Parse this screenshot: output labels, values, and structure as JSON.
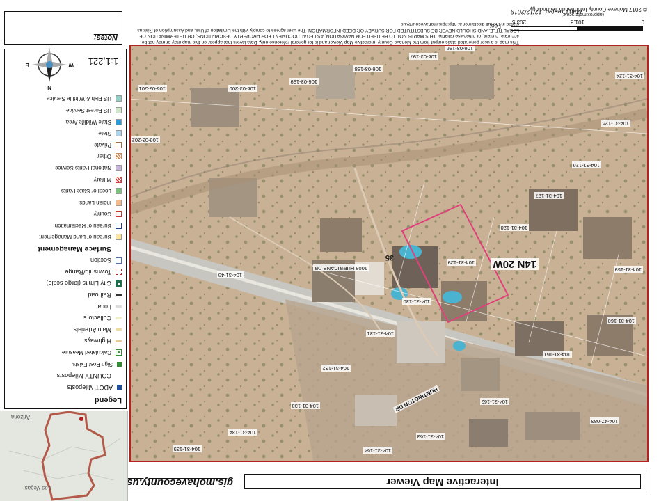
{
  "header": {
    "title": "Interactive Map Viewer",
    "url": "gis.mohavecounty.us"
  },
  "inset": {
    "labels": [
      "Las Vegas",
      "Arizona"
    ]
  },
  "map": {
    "parcels": [
      {
        "id": "p1",
        "text": "106-03-201"
      },
      {
        "id": "p2",
        "text": "106-03-200"
      },
      {
        "id": "p3",
        "text": "106-03-199"
      },
      {
        "id": "p4",
        "text": "106-03-198"
      },
      {
        "id": "p5",
        "text": "106-03-197"
      },
      {
        "id": "p6",
        "text": "106-03-196"
      },
      {
        "id": "p7",
        "text": "106-03-202"
      },
      {
        "id": "p8",
        "text": "104-31-124"
      },
      {
        "id": "p9",
        "text": "104-31-125"
      },
      {
        "id": "p10",
        "text": "104-31-126"
      },
      {
        "id": "p11",
        "text": "104-31-127"
      },
      {
        "id": "p12",
        "text": "104-31-128"
      },
      {
        "id": "p13",
        "text": "104-31-129"
      },
      {
        "id": "p14",
        "text": "104-31-130"
      },
      {
        "id": "p15",
        "text": "104-31-131"
      },
      {
        "id": "p16",
        "text": "104-31-132"
      },
      {
        "id": "p17",
        "text": "104-31-133"
      },
      {
        "id": "p18",
        "text": "104-31-134"
      },
      {
        "id": "p19",
        "text": "104-31-135"
      },
      {
        "id": "p20",
        "text": "104-31-160"
      },
      {
        "id": "p21",
        "text": "104-31-161"
      },
      {
        "id": "p22",
        "text": "104-31-162"
      },
      {
        "id": "p23",
        "text": "104-31-163"
      },
      {
        "id": "p24",
        "text": "104-31-164"
      },
      {
        "id": "p25",
        "text": "104-31-159"
      },
      {
        "id": "p26",
        "text": "104-47-083"
      },
      {
        "id": "p27",
        "text": "104-31-45"
      },
      {
        "id": "p28",
        "text": "1009 HURRICANE DR"
      }
    ],
    "township": "14N 20W",
    "section": "35",
    "street": "HUNTINGTON DR",
    "highlight_parcel": "104-31-129"
  },
  "legend": {
    "title": "Legend",
    "items": [
      {
        "label": "ADOT Mileposts",
        "kind": "sub",
        "color": "#1f4fa0",
        "shape": "square-fill"
      },
      {
        "label": "COUNTY Mileposts",
        "kind": "sub",
        "color": "",
        "shape": "none"
      },
      {
        "label": "Sign Post Exists",
        "kind": "small",
        "color": "#2e8b2e",
        "shape": "square-fill"
      },
      {
        "label": "Calculated Measure",
        "kind": "small",
        "color": "#2e8b2e",
        "shape": "dot-box"
      },
      {
        "label": "Highways",
        "kind": "sub",
        "color": "#e8c99a",
        "shape": "line"
      },
      {
        "label": "Main Arterials",
        "kind": "sub",
        "color": "#f0dca8",
        "shape": "line"
      },
      {
        "label": "Collectors",
        "kind": "sub",
        "color": "#eeeec8",
        "shape": "line"
      },
      {
        "label": "Local",
        "kind": "sub",
        "color": "#dddddd",
        "shape": "line"
      },
      {
        "label": "Railroad",
        "kind": "sub",
        "color": "#333333",
        "shape": "rail"
      },
      {
        "label": "City Limits (large scale)",
        "kind": "sub",
        "color": "#1a6e4a",
        "shape": "box-thick"
      },
      {
        "label": "Township/Range",
        "kind": "sub",
        "color": "#b22222",
        "shape": "box-dash"
      },
      {
        "label": "Section",
        "kind": "sub",
        "color": "#4a6fa5",
        "shape": "box"
      },
      {
        "label": "Surface Management",
        "kind": "head",
        "color": "",
        "shape": "none"
      },
      {
        "label": "Bureau of Land Management",
        "kind": "small",
        "color": "#fde5a0",
        "shape": "fill"
      },
      {
        "label": "Bureau of Reclamation",
        "kind": "small",
        "color": "#1f3f8f",
        "shape": "box"
      },
      {
        "label": "County",
        "kind": "small",
        "color": "#c0392b",
        "shape": "box"
      },
      {
        "label": "Indian Lands",
        "kind": "small",
        "color": "#f6b98a",
        "shape": "fill"
      },
      {
        "label": "Local or State Parks",
        "kind": "small",
        "color": "#7bc47b",
        "shape": "fill"
      },
      {
        "label": "Military",
        "kind": "small",
        "color": "#d04040",
        "shape": "hatch"
      },
      {
        "label": "National Parks Service",
        "kind": "small",
        "color": "#c6b3d9",
        "shape": "fill"
      },
      {
        "label": "Other",
        "kind": "small",
        "color": "#c78a5a",
        "shape": "hatch"
      },
      {
        "label": "Private",
        "kind": "small",
        "color": "#a07040",
        "shape": "box"
      },
      {
        "label": "State",
        "kind": "small",
        "color": "#a8d4ee",
        "shape": "fill"
      },
      {
        "label": "State Wildlife Area",
        "kind": "small",
        "color": "#2a9ad8",
        "shape": "fill"
      },
      {
        "label": "US Forest Service",
        "kind": "small",
        "color": "#cfe8c8",
        "shape": "fill"
      },
      {
        "label": "US Fish & Wildlife Service",
        "kind": "small",
        "color": "#8fd1c4",
        "shape": "fill"
      }
    ]
  },
  "scale": {
    "ratio": "1:1,221",
    "bar_ticks": [
      "0",
      "101.8",
      "203.5"
    ],
    "units": "Feet",
    "approx": "(approximate scale)"
  },
  "compass": {
    "n": "N",
    "s": "S",
    "e": "E",
    "w": "W"
  },
  "notes": {
    "title": "Notes:"
  },
  "footer": {
    "disclaimer": "This map is a user generated static output from the Mohave County Interactive Map Viewer and is for general reference only. Data layers that appear on this map may or may not be accurate, current, or otherwise reliable. THIS MAP IS NOT TO BE USED FOR NAVIGATION, AS LEGAL DOCUMENT FOR PROPERTY DESCRIPTIONS, OR DETERMINATION OF LEGAL TITLE, AND SHOULD NEVER BE SUBSTITUTED FOR SURVEY OR DEED INFORMATION. The user agrees to comply with the Limitation of Use, and Assumption of Risk as stated in the full disclaimer at http://gis.mohavecounty.us",
    "created": "Map Created: 12/12/2019",
    "copyright": "© 2017 Mohave County Information Technology"
  }
}
